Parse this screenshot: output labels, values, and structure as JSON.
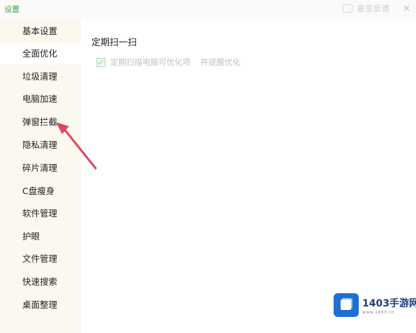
{
  "window": {
    "title": "设置",
    "feedback_label": "意见反馈",
    "close_glyph": "×"
  },
  "sidebar": {
    "items": [
      {
        "label": "基本设置",
        "active": false
      },
      {
        "label": "全面优化",
        "active": true
      },
      {
        "label": "垃圾清理",
        "active": false
      },
      {
        "label": "电脑加速",
        "active": false
      },
      {
        "label": "弹窗拦截",
        "active": false
      },
      {
        "label": "隐私清理",
        "active": false
      },
      {
        "label": "碎片清理",
        "active": false
      },
      {
        "label": "C盘瘦身",
        "active": false
      },
      {
        "label": "软件管理",
        "active": false
      },
      {
        "label": "护眼",
        "active": false
      },
      {
        "label": "文件管理",
        "active": false
      },
      {
        "label": "快速搜索",
        "active": false
      },
      {
        "label": "桌面整理",
        "active": false
      }
    ]
  },
  "main": {
    "section_title": "定期扫一扫",
    "option": {
      "label": "定期扫描电脑可优化项",
      "sub_label": "并提醒优化",
      "checked": true
    }
  },
  "watermark": {
    "name": "1403手游网",
    "url": "www.1403.cn"
  },
  "colors": {
    "accent": "#3aa64f",
    "arrow": "#e0455e",
    "watermark_blue": "#1e6fd1"
  }
}
